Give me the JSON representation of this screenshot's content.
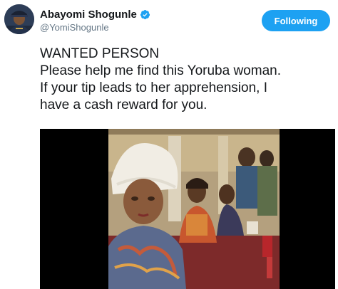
{
  "user": {
    "display_name": "Abayomi Shogunle",
    "handle": "@YomiShogunle",
    "verified_icon": "verified-badge-icon",
    "avatar_icon": "user-avatar"
  },
  "follow_button": {
    "label": "Following",
    "color": "#1da1f2"
  },
  "tweet": {
    "lines": [
      "WANTED PERSON",
      "Please help me find this Yoruba woman.",
      "If your tip leads to her apprehension, I",
      "have a cash reward for you."
    ]
  },
  "media": {
    "type": "video-thumbnail",
    "description_icon": "video-frame"
  }
}
